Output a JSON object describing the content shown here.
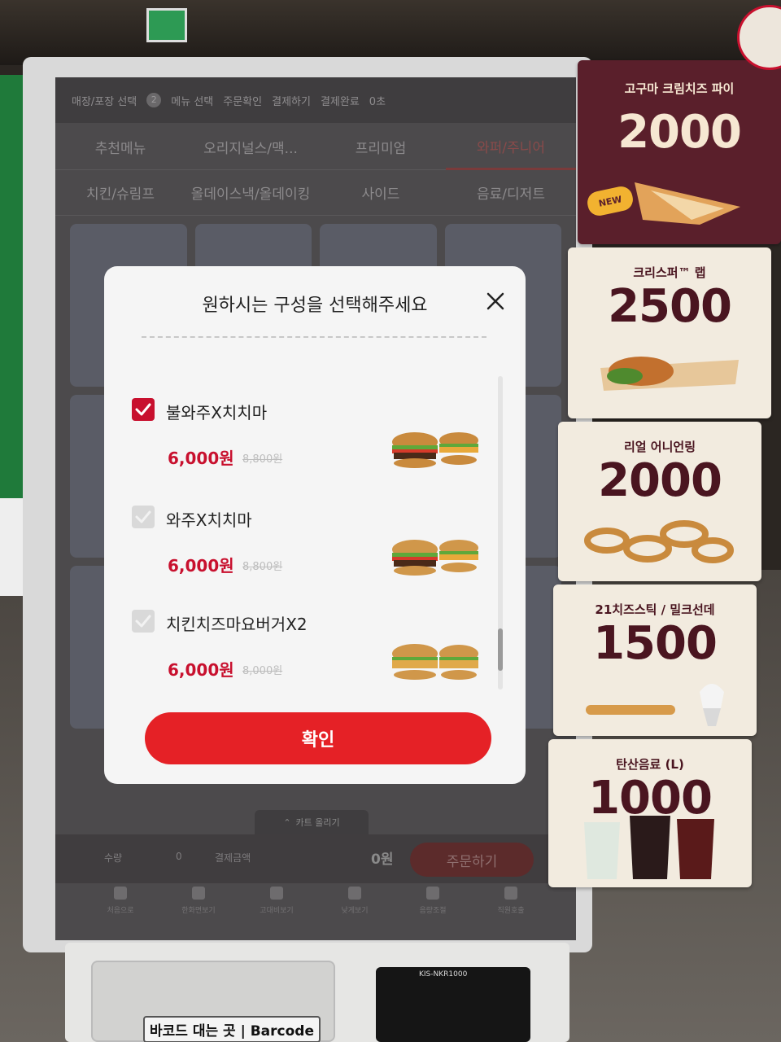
{
  "steps": [
    {
      "num": "",
      "label": "매장/포장 선택"
    },
    {
      "num": "2",
      "label": "메뉴 선택"
    },
    {
      "num": "",
      "label": "주문확인"
    },
    {
      "num": "",
      "label": "결제하기"
    },
    {
      "num": "",
      "label": "결제완료"
    },
    {
      "num": "",
      "label": "0초"
    }
  ],
  "tabs": [
    "추천메뉴",
    "오리지널스/맥...",
    "프리미엄",
    "와퍼/주니어",
    "치킨/슈림프",
    "올데이스낵/올데이킹",
    "사이드",
    "음료/디저트"
  ],
  "modal": {
    "title": "원하시는 구성을 선택해주세요",
    "options": [
      {
        "name": "불와주X치치마",
        "price": "6,000원",
        "original_price": "8,800원",
        "checked": true
      },
      {
        "name": "와주X치치마",
        "price": "6,000원",
        "original_price": "8,800원",
        "checked": false
      },
      {
        "name": "치킨치즈마요버거X2",
        "price": "6,000원",
        "original_price": "8,000원",
        "checked": false
      }
    ],
    "confirm_label": "확인"
  },
  "cart": {
    "toggle_label": "카트 올리기",
    "qty_label": "수량",
    "qty_value": "0",
    "total_label": "결제금액",
    "total_value": "0원",
    "order_label": "주문하기"
  },
  "nav": [
    "처음으로",
    "한화면보기",
    "고대비보기",
    "낮게보기",
    "음량조절",
    "직원호출"
  ],
  "promos": [
    {
      "title": "고구마 크림치즈 파이",
      "price": "2000",
      "badge": "NEW",
      "dark": true
    },
    {
      "title": "크리스퍼™ 랩",
      "price": "2500",
      "dark": false
    },
    {
      "title": "리얼 어니언링",
      "price": "2000",
      "dark": false
    },
    {
      "title": "21치즈스틱 / 밀크선데",
      "price": "1500",
      "dark": false
    },
    {
      "title": "탄산음료 (L)",
      "price": "1000",
      "dark": false
    }
  ],
  "hardware": {
    "barcode_label": "바코드 대는 곳 | Barcode",
    "reader_label": "KIS-NKR1000"
  },
  "colors": {
    "accent_red": "#e52126",
    "price_red": "#c8102e",
    "promo_dark": "#5a1f2b"
  }
}
